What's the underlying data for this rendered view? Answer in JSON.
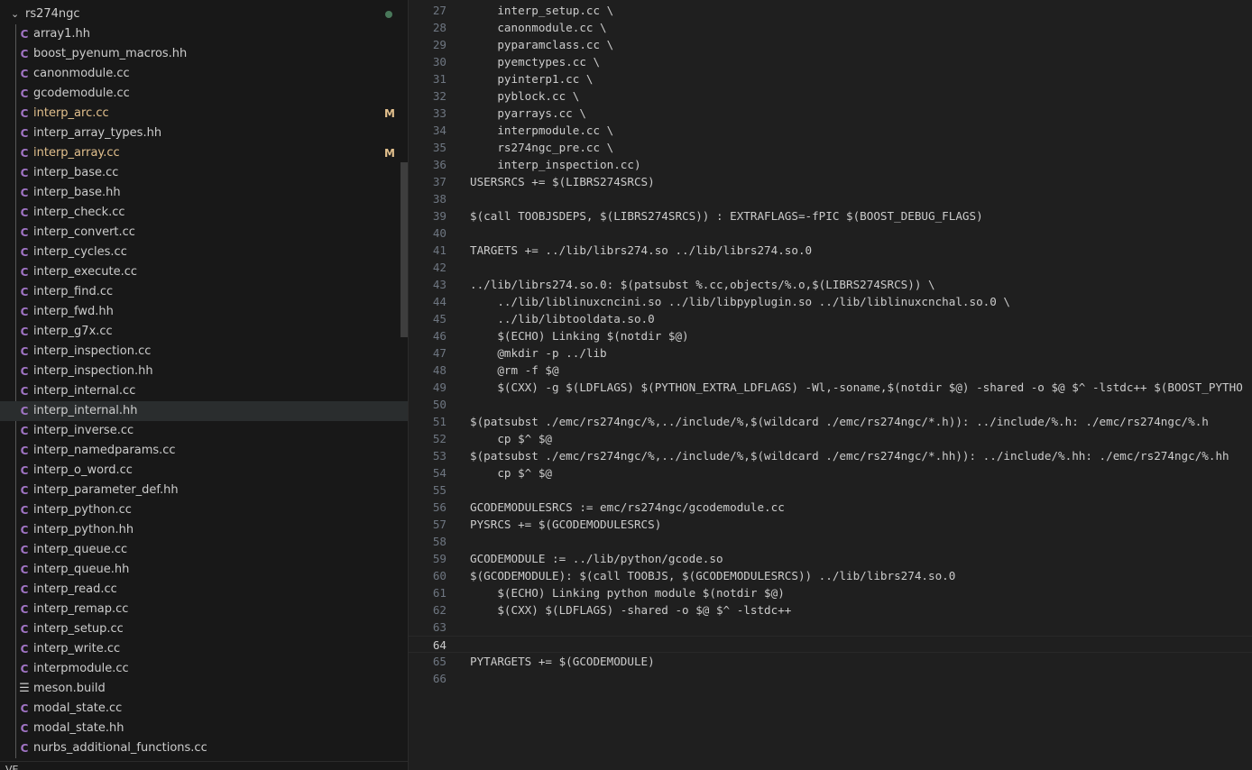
{
  "explorer": {
    "top_partial": "...",
    "folder": "rs274ngc",
    "files": [
      {
        "name": "array1.hh",
        "icon": "cpp-file-icon"
      },
      {
        "name": "boost_pyenum_macros.hh",
        "icon": "cpp-file-icon"
      },
      {
        "name": "canonmodule.cc",
        "icon": "cpp-file-icon"
      },
      {
        "name": "gcodemodule.cc",
        "icon": "cpp-file-icon"
      },
      {
        "name": "interp_arc.cc",
        "icon": "cpp-file-icon",
        "status": "M"
      },
      {
        "name": "interp_array_types.hh",
        "icon": "cpp-file-icon"
      },
      {
        "name": "interp_array.cc",
        "icon": "cpp-file-icon",
        "status": "M"
      },
      {
        "name": "interp_base.cc",
        "icon": "cpp-file-icon"
      },
      {
        "name": "interp_base.hh",
        "icon": "cpp-file-icon"
      },
      {
        "name": "interp_check.cc",
        "icon": "cpp-file-icon"
      },
      {
        "name": "interp_convert.cc",
        "icon": "cpp-file-icon"
      },
      {
        "name": "interp_cycles.cc",
        "icon": "cpp-file-icon"
      },
      {
        "name": "interp_execute.cc",
        "icon": "cpp-file-icon"
      },
      {
        "name": "interp_find.cc",
        "icon": "cpp-file-icon"
      },
      {
        "name": "interp_fwd.hh",
        "icon": "cpp-file-icon"
      },
      {
        "name": "interp_g7x.cc",
        "icon": "cpp-file-icon"
      },
      {
        "name": "interp_inspection.cc",
        "icon": "cpp-file-icon"
      },
      {
        "name": "interp_inspection.hh",
        "icon": "cpp-file-icon"
      },
      {
        "name": "interp_internal.cc",
        "icon": "cpp-file-icon"
      },
      {
        "name": "interp_internal.hh",
        "icon": "cpp-file-icon",
        "selected": true
      },
      {
        "name": "interp_inverse.cc",
        "icon": "cpp-file-icon"
      },
      {
        "name": "interp_namedparams.cc",
        "icon": "cpp-file-icon"
      },
      {
        "name": "interp_o_word.cc",
        "icon": "cpp-file-icon"
      },
      {
        "name": "interp_parameter_def.hh",
        "icon": "cpp-file-icon"
      },
      {
        "name": "interp_python.cc",
        "icon": "cpp-file-icon"
      },
      {
        "name": "interp_python.hh",
        "icon": "cpp-file-icon"
      },
      {
        "name": "interp_queue.cc",
        "icon": "cpp-file-icon"
      },
      {
        "name": "interp_queue.hh",
        "icon": "cpp-file-icon"
      },
      {
        "name": "interp_read.cc",
        "icon": "cpp-file-icon"
      },
      {
        "name": "interp_remap.cc",
        "icon": "cpp-file-icon"
      },
      {
        "name": "interp_setup.cc",
        "icon": "cpp-file-icon"
      },
      {
        "name": "interp_write.cc",
        "icon": "cpp-file-icon"
      },
      {
        "name": "interpmodule.cc",
        "icon": "cpp-file-icon"
      },
      {
        "name": "meson.build",
        "icon": "build-file-icon"
      },
      {
        "name": "modal_state.cc",
        "icon": "cpp-file-icon"
      },
      {
        "name": "modal_state.hh",
        "icon": "cpp-file-icon"
      },
      {
        "name": "nurbs_additional_functions.cc",
        "icon": "cpp-file-icon"
      }
    ],
    "bottom_partial": "VE"
  },
  "editor": {
    "current_line": 64,
    "lines": [
      {
        "n": 27,
        "text": "    interp_setup.cc \\"
      },
      {
        "n": 28,
        "text": "    canonmodule.cc \\"
      },
      {
        "n": 29,
        "text": "    pyparamclass.cc \\"
      },
      {
        "n": 30,
        "text": "    pyemctypes.cc \\"
      },
      {
        "n": 31,
        "text": "    pyinterp1.cc \\"
      },
      {
        "n": 32,
        "text": "    pyblock.cc \\"
      },
      {
        "n": 33,
        "text": "    pyarrays.cc \\"
      },
      {
        "n": 34,
        "text": "    interpmodule.cc \\"
      },
      {
        "n": 35,
        "text": "    rs274ngc_pre.cc \\"
      },
      {
        "n": 36,
        "text": "    interp_inspection.cc)"
      },
      {
        "n": 37,
        "text": "USERSRCS += $(LIBRS274SRCS)"
      },
      {
        "n": 38,
        "text": ""
      },
      {
        "n": 39,
        "text": "$(call TOOBJSDEPS, $(LIBRS274SRCS)) : EXTRAFLAGS=-fPIC $(BOOST_DEBUG_FLAGS)"
      },
      {
        "n": 40,
        "text": ""
      },
      {
        "n": 41,
        "text": "TARGETS += ../lib/librs274.so ../lib/librs274.so.0"
      },
      {
        "n": 42,
        "text": ""
      },
      {
        "n": 43,
        "text": "../lib/librs274.so.0: $(patsubst %.cc,objects/%.o,$(LIBRS274SRCS)) \\"
      },
      {
        "n": 44,
        "text": "    ../lib/liblinuxcncini.so ../lib/libpyplugin.so ../lib/liblinuxcnchal.so.0 \\"
      },
      {
        "n": 45,
        "text": "    ../lib/libtooldata.so.0"
      },
      {
        "n": 46,
        "text": "    $(ECHO) Linking $(notdir $@)"
      },
      {
        "n": 47,
        "text": "    @mkdir -p ../lib"
      },
      {
        "n": 48,
        "text": "    @rm -f $@"
      },
      {
        "n": 49,
        "text": "    $(CXX) -g $(LDFLAGS) $(PYTHON_EXTRA_LDFLAGS) -Wl,-soname,$(notdir $@) -shared -o $@ $^ -lstdc++ $(BOOST_PYTHO"
      },
      {
        "n": 50,
        "text": ""
      },
      {
        "n": 51,
        "text": "$(patsubst ./emc/rs274ngc/%,../include/%,$(wildcard ./emc/rs274ngc/*.h)): ../include/%.h: ./emc/rs274ngc/%.h"
      },
      {
        "n": 52,
        "text": "    cp $^ $@"
      },
      {
        "n": 53,
        "text": "$(patsubst ./emc/rs274ngc/%,../include/%,$(wildcard ./emc/rs274ngc/*.hh)): ../include/%.hh: ./emc/rs274ngc/%.hh"
      },
      {
        "n": 54,
        "text": "    cp $^ $@"
      },
      {
        "n": 55,
        "text": ""
      },
      {
        "n": 56,
        "text": "GCODEMODULESRCS := emc/rs274ngc/gcodemodule.cc"
      },
      {
        "n": 57,
        "text": "PYSRCS += $(GCODEMODULESRCS)"
      },
      {
        "n": 58,
        "text": ""
      },
      {
        "n": 59,
        "text": "GCODEMODULE := ../lib/python/gcode.so"
      },
      {
        "n": 60,
        "text": "$(GCODEMODULE): $(call TOOBJS, $(GCODEMODULESRCS)) ../lib/librs274.so.0"
      },
      {
        "n": 61,
        "text": "    $(ECHO) Linking python module $(notdir $@)"
      },
      {
        "n": 62,
        "text": "    $(CXX) $(LDFLAGS) -shared -o $@ $^ -lstdc++"
      },
      {
        "n": 63,
        "text": ""
      },
      {
        "n": 64,
        "text": ""
      },
      {
        "n": 65,
        "text": "PYTARGETS += $(GCODEMODULE)"
      },
      {
        "n": 66,
        "text": ""
      }
    ]
  },
  "colors": {
    "modified": "#e2c08d",
    "cpp_icon": "#a074c4",
    "editor_bg": "#1f1f1f",
    "sidebar_bg": "#181818"
  }
}
